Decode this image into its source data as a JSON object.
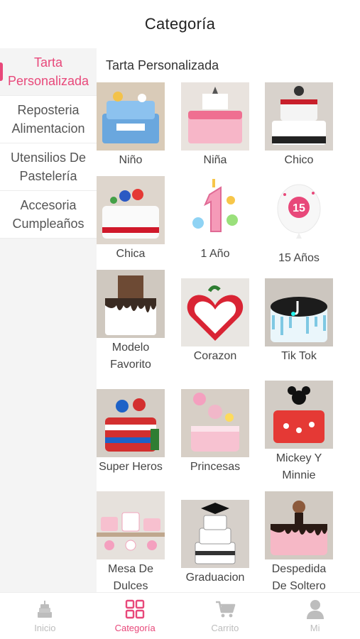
{
  "header": {
    "title": "Categoría"
  },
  "sidebar": {
    "items": [
      {
        "label": "Tarta Personalizada",
        "active": true
      },
      {
        "label": "Reposteria Alimentacion",
        "active": false
      },
      {
        "label": "Utensilios De Pastelería",
        "active": false
      },
      {
        "label": "Accesoria Cumpleaños",
        "active": false
      }
    ]
  },
  "main": {
    "section_title": "Tarta Personalizada",
    "categories": [
      {
        "label": "Niño",
        "cake": "blue",
        "icon": "cake-photo"
      },
      {
        "label": "Niña",
        "cake": "pink",
        "icon": "cake-photo"
      },
      {
        "label": "Chico",
        "cake": "white-black",
        "icon": "cake-photo"
      },
      {
        "label": "Chica",
        "cake": "white-red",
        "icon": "cake-photo"
      },
      {
        "label": "1 Año",
        "cake": "number-one",
        "icon": "number-one-illustration"
      },
      {
        "label": "15 Años",
        "cake": "balloon",
        "icon": "balloon-15"
      },
      {
        "label": "Modelo Favorito",
        "cake": "white-drip",
        "icon": "cake-photo"
      },
      {
        "label": "Corazon",
        "cake": "heart",
        "icon": "cake-photo"
      },
      {
        "label": "Tik Tok",
        "cake": "tiktok",
        "icon": "cake-photo"
      },
      {
        "label": "Super Heros",
        "cake": "hero",
        "icon": "cake-photo"
      },
      {
        "label": "Princesas",
        "cake": "princess",
        "icon": "cake-photo"
      },
      {
        "label": "Mickey Y Minnie",
        "cake": "mickey",
        "icon": "cake-photo"
      },
      {
        "label": "Mesa De Dulces",
        "cake": "table",
        "icon": "cake-photo"
      },
      {
        "label": "Graduacion",
        "cake": "graduation",
        "icon": "cake-photo"
      },
      {
        "label": "Despedida De Soltero",
        "cake": "party",
        "icon": "cake-photo"
      }
    ]
  },
  "tabbar": {
    "items": [
      {
        "label": "Inicio",
        "icon": "cake-icon",
        "active": false
      },
      {
        "label": "Categoría",
        "icon": "grid-icon",
        "active": true
      },
      {
        "label": "Carrito",
        "icon": "cart-icon",
        "active": false
      },
      {
        "label": "Mi",
        "icon": "user-icon",
        "active": false
      }
    ]
  },
  "colors": {
    "accent": "#e8487a",
    "inactive": "#bdbdbd",
    "sidebar_bg": "#f4f4f4"
  }
}
